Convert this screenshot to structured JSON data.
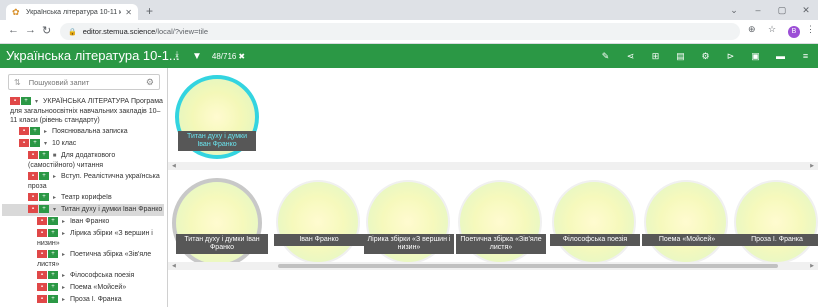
{
  "browser": {
    "tab_title": "Українська література 10-11 кл",
    "tab_close": "✕",
    "new_tab": "+",
    "url_host": "editor.stemua.science",
    "url_path": "/local/?view=tile",
    "profile_letter": "B",
    "window_controls": [
      "⌄",
      "–",
      "▢",
      "✕"
    ]
  },
  "app": {
    "title": "Українська література 10-1...",
    "counter": "48/716",
    "accent_color": "#2b9845"
  },
  "sidebar": {
    "search_placeholder": "Пошуковий запит",
    "tree": [
      {
        "label": "УКРАЇНСЬКА ЛІТЕРАТУРА Програма для загальноосвітніх навчальних закладів 10–11 класи (рівень стандарту)",
        "indent": 0,
        "marker": "▾",
        "selected": false
      },
      {
        "label": "Пояснювальна записка",
        "indent": 1,
        "marker": "▸",
        "selected": false
      },
      {
        "label": "10 клас",
        "indent": 1,
        "marker": "▾",
        "selected": false
      },
      {
        "label": "Для додаткового (самостійного) читання",
        "indent": 2,
        "marker": "■",
        "selected": false
      },
      {
        "label": "Вступ. Реалістична українська проза",
        "indent": 2,
        "marker": "▸",
        "selected": false
      },
      {
        "label": "Театр корифеїв",
        "indent": 2,
        "marker": "▸",
        "selected": false
      },
      {
        "label": "Титан духу і думки Іван Франко",
        "indent": 2,
        "marker": "▾",
        "selected": true
      },
      {
        "label": "Іван Франко",
        "indent": 3,
        "marker": "▸",
        "selected": false
      },
      {
        "label": "Лірика збірки «З вершин і низин»",
        "indent": 3,
        "marker": "▸",
        "selected": false
      },
      {
        "label": "Поетична збірка «Зів'яле листя»",
        "indent": 3,
        "marker": "▸",
        "selected": false
      },
      {
        "label": "Філософська поезія",
        "indent": 3,
        "marker": "▸",
        "selected": false
      },
      {
        "label": "Поема «Мойсей»",
        "indent": 3,
        "marker": "▸",
        "selected": false
      },
      {
        "label": "Проза І. Франка",
        "indent": 3,
        "marker": "▸",
        "selected": false
      }
    ]
  },
  "canvas": {
    "top_node_label": "Титан духу і думки Іван Франко",
    "children": [
      "Титан духу і думки Іван Франко",
      "Іван Франко",
      "Лірика збірки «З вершин і низин»",
      "Поетична збірка «Зів'яле листя»",
      "Філософська поезія",
      "Поема «Мойсей»",
      "Проза І. Франка"
    ]
  }
}
